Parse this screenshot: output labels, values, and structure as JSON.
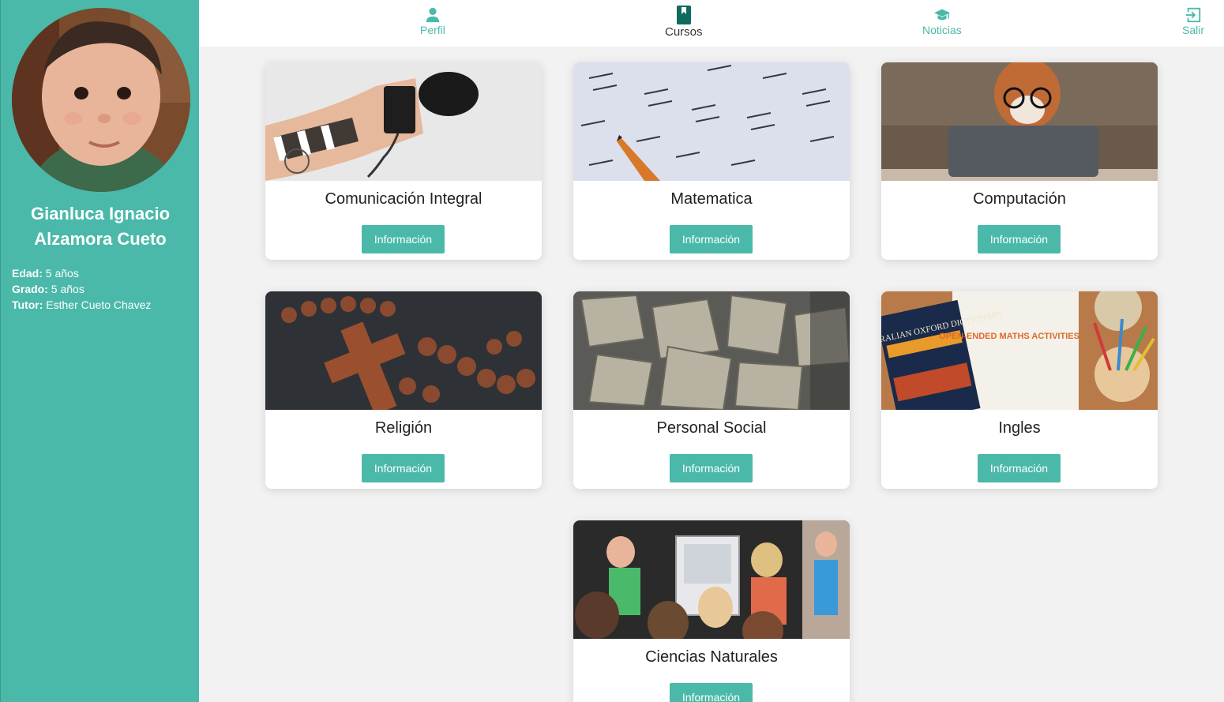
{
  "student": {
    "name": "Gianluca Ignacio Alzamora Cueto",
    "age_label": "Edad:",
    "age_value": "5 años",
    "grade_label": "Grado:",
    "grade_value": "5 años",
    "tutor_label": "Tutor:",
    "tutor_value": "Esther Cueto Chavez"
  },
  "nav": {
    "perfil": "Perfil",
    "cursos": "Cursos",
    "noticias": "Noticias",
    "salir": "Salir"
  },
  "courses": [
    {
      "title": "Comunicación Integral",
      "button": "Información"
    },
    {
      "title": "Matematica",
      "button": "Información"
    },
    {
      "title": "Computación",
      "button": "Información"
    },
    {
      "title": "Religión",
      "button": "Información"
    },
    {
      "title": "Personal Social",
      "button": "Información"
    },
    {
      "title": "Ingles",
      "button": "Información"
    },
    {
      "title": "Ciencias Naturales",
      "button": "Información"
    }
  ],
  "book_cover": {
    "dictionary": "THE AUSTRALIAN OXFORD DICTIONARY",
    "activities": "OPEN-ENDED MATHS ACTIVITIES"
  },
  "colors": {
    "accent": "#4ab9a9",
    "background": "#f2f2f2"
  }
}
